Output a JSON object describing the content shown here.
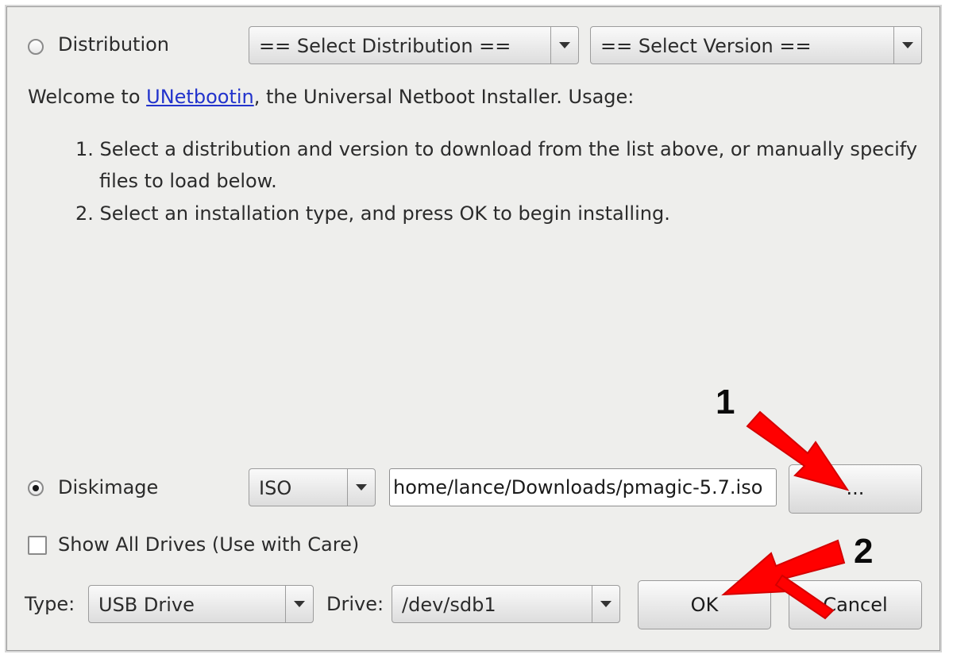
{
  "distribution": {
    "radio_label": "Distribution",
    "select_distribution": "== Select Distribution ==",
    "select_version": "== Select Version =="
  },
  "intro": {
    "welcome_prefix": "Welcome to ",
    "app_link": "UNetbootin",
    "welcome_suffix": ", the Universal Netboot Installer. Usage:",
    "step1_line1": "1. Select a distribution and version to download from the list above, or manually specify",
    "step1_line2": "files to load below.",
    "step2": "2. Select an installation type, and press OK to begin installing."
  },
  "diskimage": {
    "radio_label": "Diskimage",
    "format": "ISO",
    "path": "home/lance/Downloads/pmagic-5.7.iso",
    "browse_label": "..."
  },
  "show_all_drives": {
    "label": "Show All Drives (Use with Care)",
    "checked": false
  },
  "bottom": {
    "type_label": "Type:",
    "type_value": "USB Drive",
    "drive_label": "Drive:",
    "drive_value": "/dev/sdb1",
    "ok_label": "OK",
    "cancel_label": "Cancel"
  },
  "annotations": {
    "marker1": "1",
    "marker2": "2",
    "arrow_color": "#ff0000"
  }
}
